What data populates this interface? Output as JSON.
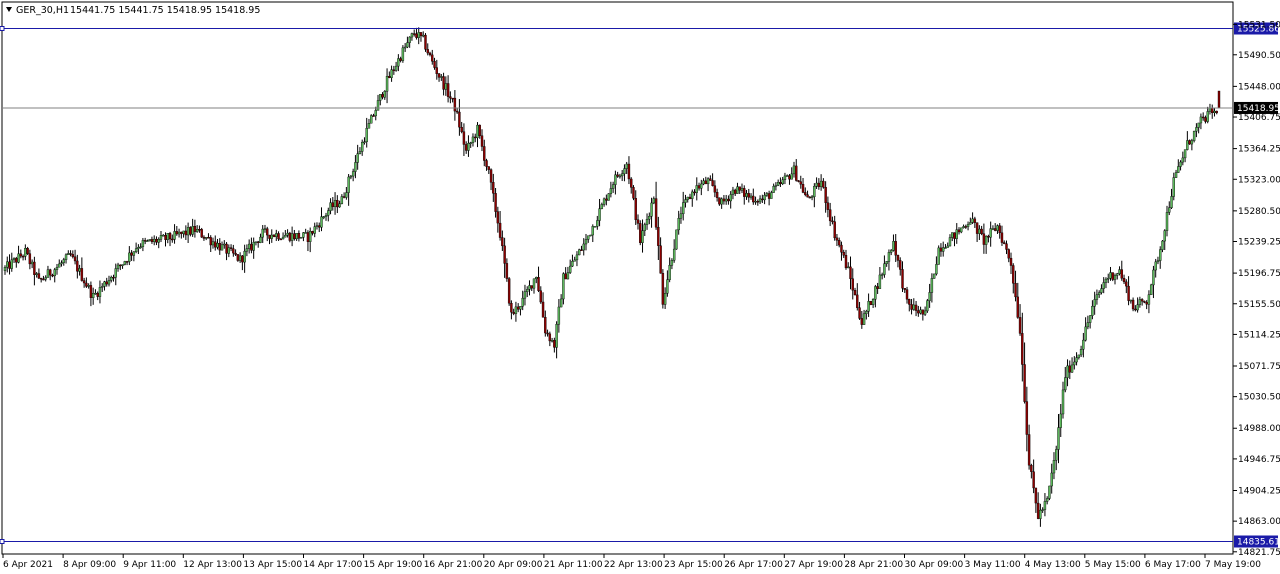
{
  "header": {
    "menu_icon": "triangle-down-icon",
    "symbol": "GER_30,H1",
    "ohlc": "15441.75 15441.75 15418.95 15418.95"
  },
  "chart_data": {
    "type": "candlestick",
    "symbol": "GER_30",
    "timeframe": "H1",
    "ylim": [
      14821.75,
      15546.75
    ],
    "y_tick_labels": [
      "15531.50",
      "15490.50",
      "15448.00",
      "15406.75",
      "15364.25",
      "15323.00",
      "15280.50",
      "15239.25",
      "15196.75",
      "15155.50",
      "15114.25",
      "15071.75",
      "15030.50",
      "14988.00",
      "14946.75",
      "14904.25",
      "14863.00",
      "14821.75"
    ],
    "x_tick_labels": [
      "6 Apr 2021",
      "8 Apr 09:00",
      "9 Apr 11:00",
      "12 Apr 13:00",
      "13 Apr 15:00",
      "14 Apr 17:00",
      "15 Apr 19:00",
      "16 Apr 21:00",
      "20 Apr 09:00",
      "21 Apr 11:00",
      "22 Apr 13:00",
      "23 Apr 15:00",
      "26 Apr 17:00",
      "27 Apr 19:00",
      "28 Apr 21:00",
      "30 Apr 09:00",
      "3 May 11:00",
      "4 May 13:00",
      "5 May 15:00",
      "6 May 17:00",
      "7 May 19:00"
    ],
    "price_lines": [
      {
        "price": 15525.86,
        "label": "15525.86",
        "color": "#1a1aa8",
        "kind": "horizontal-line"
      },
      {
        "price": 15418.95,
        "label": "15418.95",
        "color": "#808080",
        "kind": "bid-line"
      },
      {
        "price": 14835.61,
        "label": "14835.61",
        "color": "#1a1aa8",
        "kind": "horizontal-line"
      }
    ],
    "anchors": [
      [
        0,
        15200
      ],
      [
        10,
        15225
      ],
      [
        16,
        15185
      ],
      [
        30,
        15220
      ],
      [
        40,
        15165
      ],
      [
        50,
        15200
      ],
      [
        60,
        15235
      ],
      [
        75,
        15245
      ],
      [
        85,
        15255
      ],
      [
        95,
        15235
      ],
      [
        105,
        15215
      ],
      [
        115,
        15250
      ],
      [
        125,
        15248
      ],
      [
        135,
        15245
      ],
      [
        145,
        15285
      ],
      [
        150,
        15295
      ],
      [
        160,
        15380
      ],
      [
        170,
        15455
      ],
      [
        177,
        15495
      ],
      [
        182,
        15520
      ],
      [
        186,
        15510
      ],
      [
        190,
        15480
      ],
      [
        196,
        15445
      ],
      [
        200,
        15420
      ],
      [
        205,
        15360
      ],
      [
        210,
        15390
      ],
      [
        215,
        15330
      ],
      [
        220,
        15250
      ],
      [
        225,
        15140
      ],
      [
        230,
        15160
      ],
      [
        236,
        15195
      ],
      [
        240,
        15120
      ],
      [
        244,
        15100
      ],
      [
        248,
        15190
      ],
      [
        258,
        15240
      ],
      [
        264,
        15280
      ],
      [
        270,
        15320
      ],
      [
        276,
        15345
      ],
      [
        282,
        15240
      ],
      [
        288,
        15300
      ],
      [
        292,
        15160
      ],
      [
        300,
        15280
      ],
      [
        306,
        15310
      ],
      [
        312,
        15320
      ],
      [
        318,
        15290
      ],
      [
        324,
        15310
      ],
      [
        330,
        15300
      ],
      [
        336,
        15295
      ],
      [
        342,
        15310
      ],
      [
        350,
        15335
      ],
      [
        356,
        15295
      ],
      [
        362,
        15320
      ],
      [
        368,
        15250
      ],
      [
        374,
        15200
      ],
      [
        380,
        15130
      ],
      [
        388,
        15190
      ],
      [
        394,
        15240
      ],
      [
        400,
        15155
      ],
      [
        408,
        15140
      ],
      [
        414,
        15230
      ],
      [
        422,
        15250
      ],
      [
        428,
        15270
      ],
      [
        434,
        15240
      ],
      [
        440,
        15260
      ],
      [
        446,
        15210
      ],
      [
        450,
        15120
      ],
      [
        454,
        14940
      ],
      [
        458,
        14870
      ],
      [
        462,
        14890
      ],
      [
        466,
        14960
      ],
      [
        470,
        15060
      ],
      [
        476,
        15090
      ],
      [
        482,
        15150
      ],
      [
        488,
        15190
      ],
      [
        494,
        15200
      ],
      [
        500,
        15150
      ],
      [
        506,
        15160
      ],
      [
        512,
        15230
      ],
      [
        518,
        15320
      ],
      [
        524,
        15370
      ],
      [
        530,
        15400
      ],
      [
        535,
        15415
      ],
      [
        537,
        15410
      ]
    ],
    "last_candle": {
      "open": 15441.75,
      "high": 15441.75,
      "low": 15418.95,
      "close": 15418.95
    },
    "colors": {
      "bull": "#5cb85c",
      "bear": "#8b0000",
      "wick": "#000000",
      "grid_border": "#000000",
      "label_fill": "#1a1aa8",
      "bid_label_fill": "#000000"
    },
    "grid": false
  }
}
